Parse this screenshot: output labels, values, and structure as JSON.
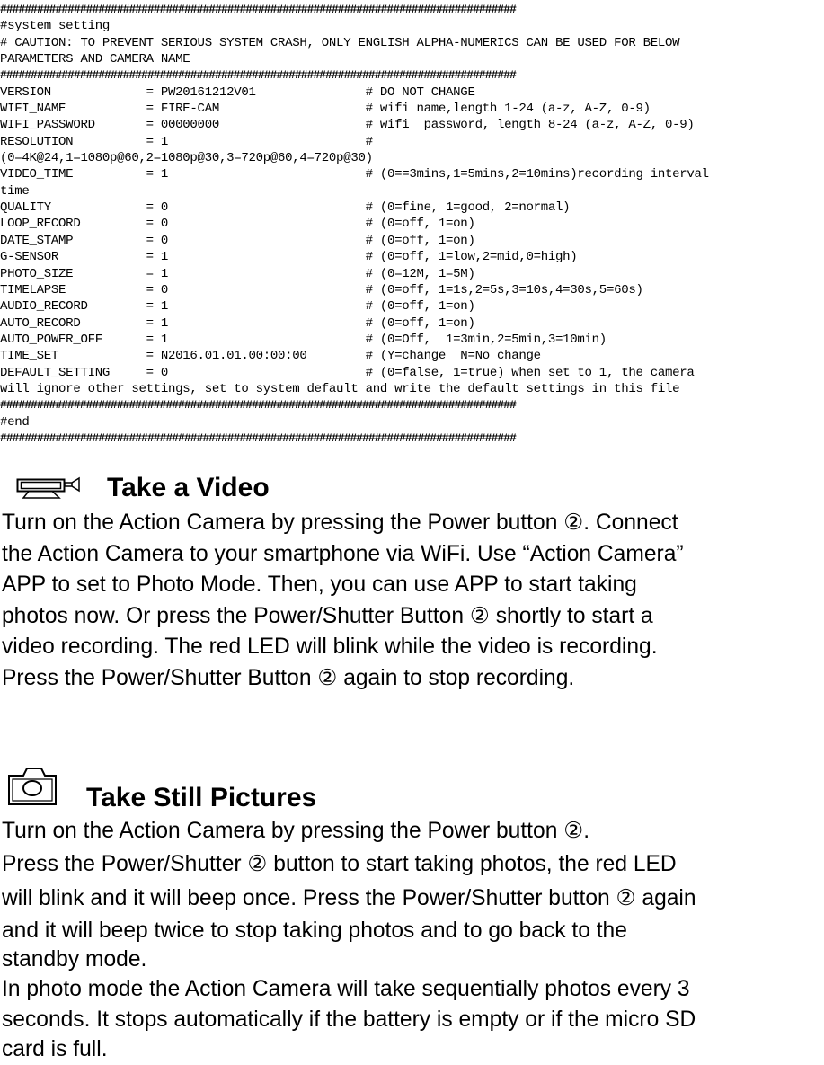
{
  "config_file": {
    "lines": [
      {
        "kind": "hash",
        "text": "####################################################################################"
      },
      {
        "kind": "text",
        "text": "#system setting"
      },
      {
        "kind": "text",
        "text": "# CAUTION: TO PREVENT SERIOUS SYSTEM CRASH, ONLY ENGLISH ALPHA-NUMERICS CAN BE USED FOR BELOW"
      },
      {
        "kind": "text",
        "text": "PARAMETERS AND CAMERA NAME"
      },
      {
        "kind": "hash",
        "text": "####################################################################################"
      },
      {
        "kind": "setting",
        "key": "VERSION",
        "value": "PW20161212V01",
        "comment": "# DO NOT CHANGE"
      },
      {
        "kind": "setting",
        "key": "WIFI_NAME",
        "value": "FIRE-CAM",
        "comment": "# wifi name,length 1-24 (a-z, A-Z, 0-9)"
      },
      {
        "kind": "setting",
        "key": "WIFI_PASSWORD",
        "value": "00000000",
        "comment": "# wifi  password, length 8-24 (a-z, A-Z, 0-9)"
      },
      {
        "kind": "setting",
        "key": "RESOLUTION",
        "value": "1",
        "comment": "#"
      },
      {
        "kind": "text",
        "text": "(0=4K@24,1=1080p@60,2=1080p@30,3=720p@60,4=720p@30)"
      },
      {
        "kind": "setting",
        "key": "VIDEO_TIME",
        "value": "1",
        "comment": "# (0==3mins,1=5mins,2=10mins)recording interval"
      },
      {
        "kind": "text",
        "text": "time"
      },
      {
        "kind": "setting",
        "key": "QUALITY",
        "value": "0",
        "comment": "# (0=fine, 1=good, 2=normal)"
      },
      {
        "kind": "setting",
        "key": "LOOP_RECORD",
        "value": "0",
        "comment": "# (0=off, 1=on)"
      },
      {
        "kind": "setting",
        "key": "DATE_STAMP",
        "value": "0",
        "comment": "# (0=off, 1=on)"
      },
      {
        "kind": "setting",
        "key": "G-SENSOR",
        "value": "1",
        "comment": "# (0=off, 1=low,2=mid,0=high)"
      },
      {
        "kind": "setting",
        "key": "PHOTO_SIZE",
        "value": "1",
        "comment": "# (0=12M, 1=5M)"
      },
      {
        "kind": "setting",
        "key": "TIMELAPSE",
        "value": "0",
        "comment": "# (0=off, 1=1s,2=5s,3=10s,4=30s,5=60s)"
      },
      {
        "kind": "setting",
        "key": "AUDIO_RECORD",
        "value": "1",
        "comment": "# (0=off, 1=on)"
      },
      {
        "kind": "setting",
        "key": "AUTO_RECORD",
        "value": "1",
        "comment": "# (0=off, 1=on)"
      },
      {
        "kind": "setting",
        "key": "AUTO_POWER_OFF",
        "value": "1",
        "comment": "# (0=Off,  1=3min,2=5min,3=10min)"
      },
      {
        "kind": "setting",
        "key": "TIME_SET",
        "value": "N2016.01.01.00:00:00",
        "comment": "# (Y=change  N=No change"
      },
      {
        "kind": "setting",
        "key": "DEFAULT_SETTING",
        "value": "0",
        "comment": "# (0=false, 1=true) when set to 1, the camera"
      },
      {
        "kind": "text",
        "text": "will ignore other settings, set to system default and write the default settings in this file"
      },
      {
        "kind": "hash",
        "text": "####################################################################################"
      },
      {
        "kind": "text",
        "text": "#end"
      },
      {
        "kind": "hash",
        "text": "####################################################################################"
      }
    ]
  },
  "sections": {
    "video": {
      "icon": "video-camera-icon",
      "title": "Take a Video",
      "lines": [
        "Turn on the Action Camera by pressing the Power button ②. Connect",
        "the Action Camera to your smartphone via WiFi. Use “Action Camera”",
        "APP to set to Photo Mode. Then, you can use APP to start taking",
        "photos now. Or press the Power/Shutter Button ② shortly to start a",
        "video recording. The red LED will blink while the video is recording.",
        "Press the Power/Shutter Button ② again to stop recording."
      ]
    },
    "photo": {
      "icon": "camera-icon",
      "title": "Take Still Pictures",
      "lines": [
        "Turn on the Action Camera by pressing the Power button ②.",
        "Press the Power/Shutter ② button to start taking photos, the red LED",
        "will blink and it will beep once. Press the Power/Shutter button ② again",
        "and it will beep twice to stop taking photos and to go back to the",
        "standby mode.",
        "In photo mode the Action Camera will take sequentially photos every 3",
        "seconds. It stops automatically if the battery is empty or if the micro SD",
        "card is full."
      ]
    }
  }
}
